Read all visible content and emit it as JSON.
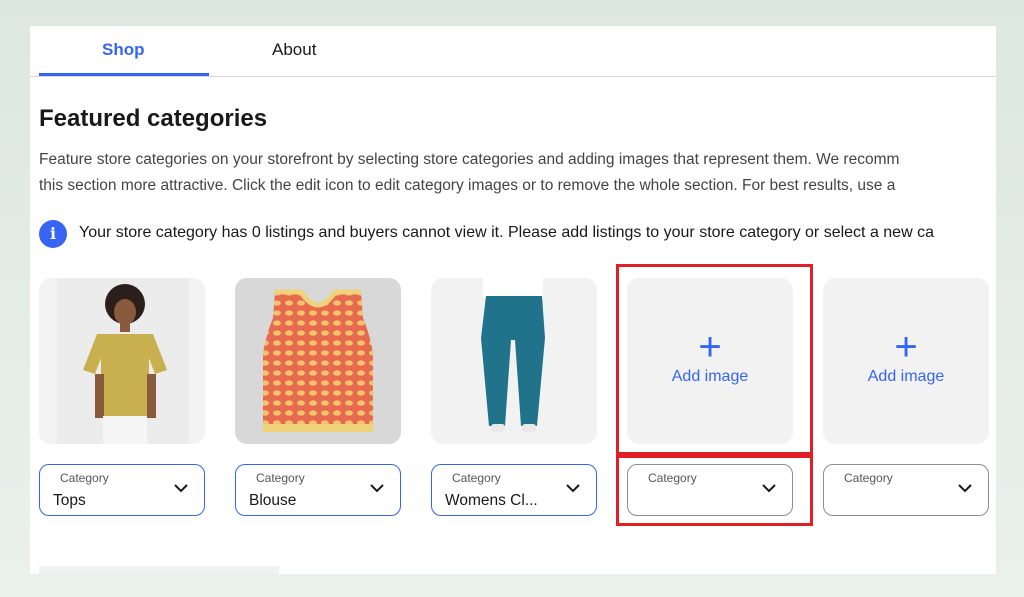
{
  "tabs": [
    {
      "label": "Shop",
      "active": true
    },
    {
      "label": "About",
      "active": false
    }
  ],
  "section": {
    "title": "Featured categories",
    "description_line1": "Feature store categories on your storefront by selecting store categories and adding images that represent them. We recomm",
    "description_line2": "this section more attractive. Click the edit icon to edit category images or to remove the whole section. For best results, use a"
  },
  "notice": {
    "icon": "info-icon",
    "text": "Your store category has 0 listings and buyers cannot view it. Please add listings to your store category or select a new ca"
  },
  "cards": [
    {
      "image": "yellow-tshirt-model",
      "dropdown_label": "Category",
      "dropdown_value": "Tops"
    },
    {
      "image": "knit-vest-top",
      "dropdown_label": "Category",
      "dropdown_value": "Blouse"
    },
    {
      "image": "teal-scrub-pants",
      "dropdown_label": "Category",
      "dropdown_value": "Womens Cl..."
    },
    {
      "add_label": "Add image",
      "dropdown_label": "Category",
      "dropdown_value": ""
    },
    {
      "add_label": "Add image",
      "dropdown_label": "Category",
      "dropdown_value": ""
    }
  ],
  "colors": {
    "accent": "#3665f3",
    "highlight": "#e01f26",
    "card_bg": "#f2f2f2"
  }
}
